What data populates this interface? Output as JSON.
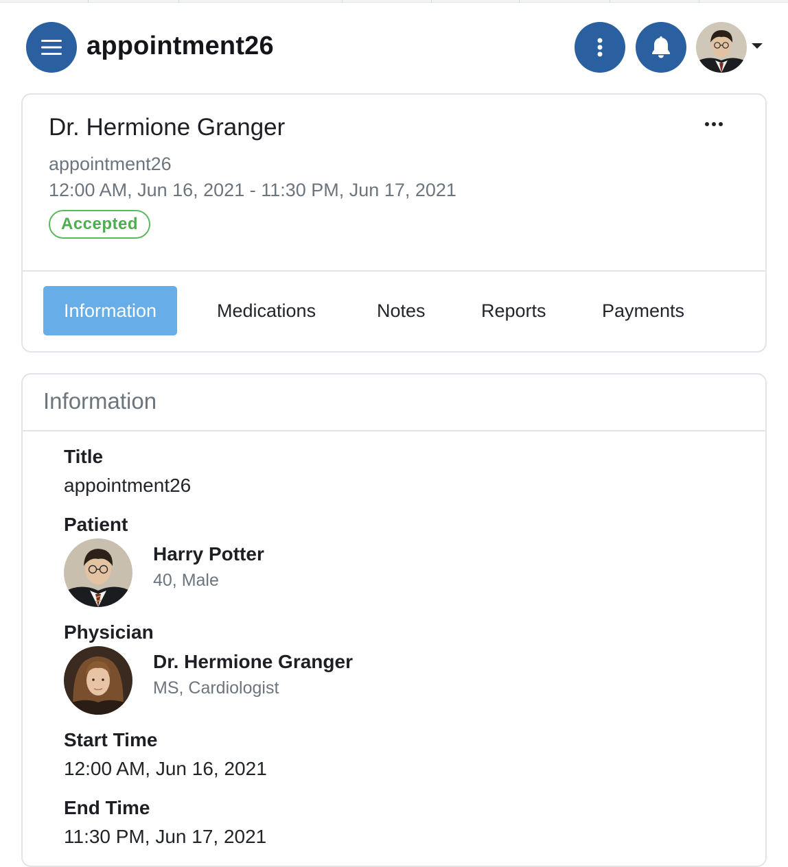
{
  "header": {
    "title": "appointment26",
    "menu_icon": "hamburger-menu-icon",
    "options_icon": "vertical-dots-icon",
    "notification_icon": "bell-icon",
    "avatar_icon": "user-avatar"
  },
  "appointment": {
    "physician_name": "Dr. Hermione Granger",
    "title": "appointment26",
    "time_range": "12:00 AM, Jun 16, 2021 - 11:30 PM, Jun 17, 2021",
    "status": "Accepted",
    "more_icon": "horizontal-dots-icon"
  },
  "tabs": [
    {
      "label": "Information",
      "active": true
    },
    {
      "label": "Medications",
      "active": false
    },
    {
      "label": "Notes",
      "active": false
    },
    {
      "label": "Reports",
      "active": false
    },
    {
      "label": "Payments",
      "active": false
    }
  ],
  "information": {
    "heading": "Information",
    "title_label": "Title",
    "title_value": "appointment26",
    "patient_label": "Patient",
    "patient": {
      "name": "Harry Potter",
      "details": "40, Male"
    },
    "physician_label": "Physician",
    "physician": {
      "name": "Dr. Hermione Granger",
      "details": "MS, Cardiologist"
    },
    "start_label": "Start Time",
    "start_value": "12:00 AM, Jun 16, 2021",
    "end_label": "End Time",
    "end_value": "11:30 PM, Jun 17, 2021"
  },
  "colors": {
    "primary": "#2a5fa0",
    "tab_active": "#67ade8",
    "status_accepted": "#5cb85c"
  }
}
